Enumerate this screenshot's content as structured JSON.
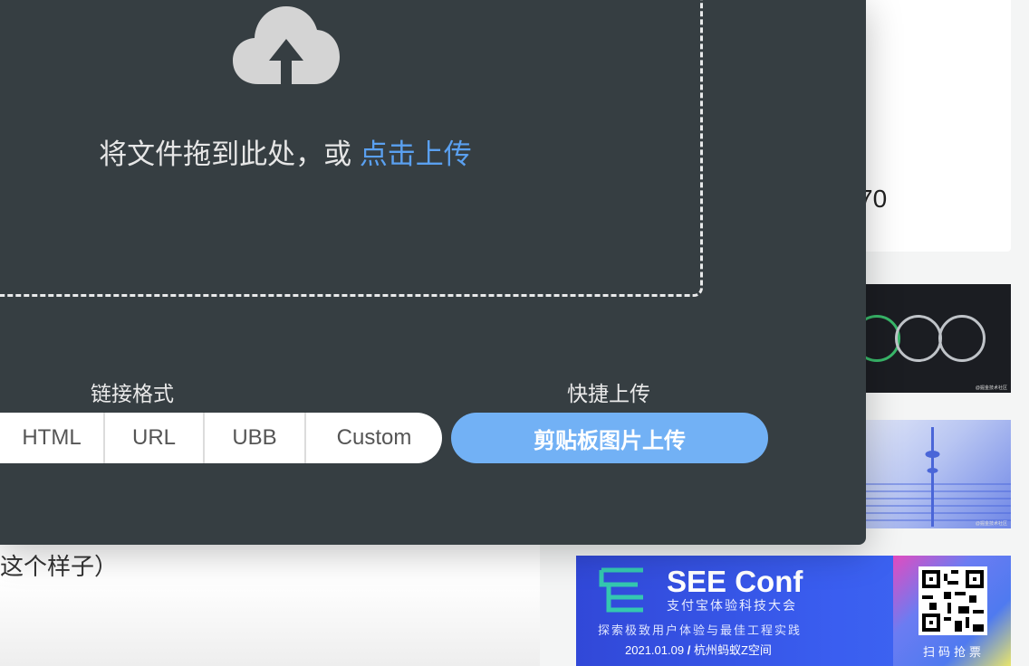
{
  "background": {
    "left_text": "这个样子）",
    "card_number": "70",
    "watermark": "@掘金技术社区"
  },
  "upload": {
    "drop_text": "将文件拖到此处，或 ",
    "drop_link": "点击上传",
    "icon": "cloud-upload-icon"
  },
  "link_format": {
    "label": "链接格式",
    "options": [
      "HTML",
      "URL",
      "UBB",
      "Custom"
    ]
  },
  "quick_upload": {
    "label": "快捷上传",
    "button": "剪贴板图片上传"
  },
  "ad": {
    "title": "SEE Conf",
    "subtitle": "支付宝体验科技大会",
    "tagline": "探索极致用户体验与最佳工程实践",
    "date": "2021.01.09",
    "separator": "/",
    "location": "杭州蚂蚁Z空间",
    "qr_label": "扫码抢票"
  },
  "colors": {
    "modal_bg": "#363e42",
    "accent": "#72b1f5",
    "link": "#5aa0f0"
  }
}
